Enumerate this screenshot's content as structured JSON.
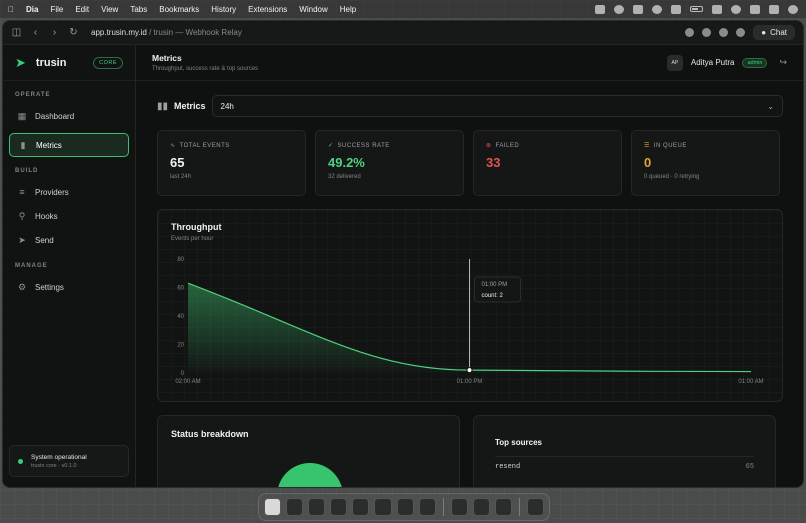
{
  "menubar": {
    "app": "Dia",
    "items": [
      "File",
      "Edit",
      "View",
      "Tabs",
      "Bookmarks",
      "History",
      "Extensions",
      "Window",
      "Help"
    ]
  },
  "browser": {
    "url_host": "app.trusin.my.id",
    "url_rest": " / trusin — Webhook Relay",
    "chat_label": "Chat"
  },
  "sidebar": {
    "brand": "trusin",
    "brand_badge": "CORE",
    "sections": {
      "operate": "OPERATE",
      "build": "BUILD",
      "manage": "MANAGE"
    },
    "items": {
      "dashboard": "Dashboard",
      "metrics": "Metrics",
      "providers": "Providers",
      "hooks": "Hooks",
      "send": "Send",
      "settings": "Settings"
    },
    "status": {
      "title": "System operational",
      "version": "trusin core · v0.1.0"
    }
  },
  "header": {
    "title": "Metrics",
    "subtitle": "Throughput, success rate & top sources",
    "user_initials": "AP",
    "user_name": "Aditya Putra",
    "user_role": "admin"
  },
  "metrics_bar": {
    "title": "Metrics",
    "range": "24h"
  },
  "cards": {
    "total": {
      "label": "TOTAL EVENTS",
      "value": "65",
      "caption": "last 24h"
    },
    "success": {
      "label": "SUCCESS RATE",
      "value": "49.2%",
      "caption": "32 delivered"
    },
    "failed": {
      "label": "FAILED",
      "value": "33",
      "caption": ""
    },
    "queue": {
      "label": "IN QUEUE",
      "value": "0",
      "caption": "0 queued · 0 retrying"
    }
  },
  "colors": {
    "green": "#4ed17f",
    "red": "#e0534f",
    "amber": "#e3a431"
  },
  "throughput": {
    "title": "Throughput",
    "subtitle": "Events per hour",
    "tooltip_time": "01:00 PM",
    "tooltip_value": "count: 2"
  },
  "chart_data": {
    "type": "area",
    "title": "Throughput",
    "subtitle": "Events per hour",
    "x": [
      "02:00 AM",
      "01:00 PM",
      "01:00 AM"
    ],
    "series": [
      {
        "values": [
          63,
          2,
          1
        ]
      }
    ],
    "ylim": [
      0,
      80
    ],
    "yticks": [
      0,
      20,
      40,
      60,
      80
    ],
    "grid": true
  },
  "status_breakdown": {
    "title": "Status breakdown"
  },
  "top_sources": {
    "title": "Top sources",
    "rows": [
      {
        "name": "resend",
        "count": "65"
      }
    ]
  }
}
